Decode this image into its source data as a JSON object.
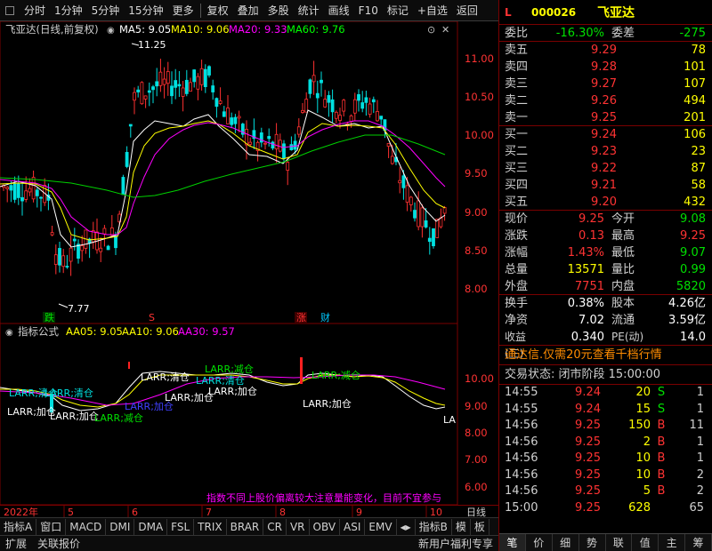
{
  "toolbar": {
    "items": [
      "分时",
      "1分钟",
      "5分钟",
      "15分钟",
      "更多",
      "复权",
      "叠加",
      "多股",
      "统计",
      "画线",
      "F10",
      "标记",
      "+自选",
      "返回"
    ]
  },
  "chart_header": {
    "stock": "飞亚达(日线,前复权)",
    "ma5": "MA5: 9.05",
    "ma10": "MA10: 9.06",
    "ma20": "MA20: 9.33",
    "ma60": "MA60: 9.76"
  },
  "indicator_header": {
    "name": "指标公式",
    "aa05": "AA05: 9.05",
    "aa10": "AA10: 9.06",
    "aa30": "AA30: 9.57"
  },
  "price_annotations": {
    "high": "11.25",
    "low": "7.77"
  },
  "price_axis": [
    "11.00",
    "10.50",
    "10.00",
    "9.50",
    "9.00",
    "8.50",
    "8.00"
  ],
  "ind_axis": [
    "10.00",
    "9.00",
    "8.00",
    "7.00",
    "6.00"
  ],
  "event_markers": {
    "die": "跌",
    "s": "S",
    "zhang": "涨",
    "cai": "财"
  },
  "ind_labels": [
    {
      "t": "LARR;清仓"
    },
    {
      "t": "LARR;清仓"
    },
    {
      "t": "LARR;加仓"
    },
    {
      "t": "LARR;加仓"
    },
    {
      "t": "LARR;减仓"
    },
    {
      "t": "LARR;加仓"
    },
    {
      "t": "LARR;清仓"
    },
    {
      "t": "LARR;加仓"
    },
    {
      "t": "LARR;减仓"
    },
    {
      "t": "LARR;清仓"
    },
    {
      "t": "LARR;加仓"
    },
    {
      "t": "LARR;减仓"
    },
    {
      "t": "LARR;加仓"
    },
    {
      "t": "LA"
    }
  ],
  "warning": "指数不同上股价偏离较大注意量能变化，目前不宜参与",
  "date_axis": {
    "year": "2022年",
    "months": [
      "5",
      "6",
      "7",
      "8",
      "9",
      "10"
    ],
    "period": "日线"
  },
  "bottom_tabs": [
    "指标A",
    "窗口",
    "MACD",
    "DMI",
    "DMA",
    "FSL",
    "TRIX",
    "BRAR",
    "CR",
    "VR",
    "OBV",
    "ASI",
    "EMV",
    "指标B",
    "模",
    "板"
  ],
  "status_bar": {
    "expand": "扩展",
    "link": "关联报价",
    "promo": "新用户福利专享"
  },
  "quote": {
    "mark": "L",
    "code": "000026",
    "name": "飞亚达",
    "weibi_label": "委比",
    "weibi": "-16.30%",
    "weicha_label": "委差",
    "weicha": "-275",
    "asks": [
      {
        "label": "卖五",
        "price": "9.29",
        "vol": "78"
      },
      {
        "label": "卖四",
        "price": "9.28",
        "vol": "101"
      },
      {
        "label": "卖三",
        "price": "9.27",
        "vol": "107"
      },
      {
        "label": "卖二",
        "price": "9.26",
        "vol": "494"
      },
      {
        "label": "卖一",
        "price": "9.25",
        "vol": "201"
      }
    ],
    "bids": [
      {
        "label": "买一",
        "price": "9.24",
        "vol": "106"
      },
      {
        "label": "买二",
        "price": "9.23",
        "vol": "23"
      },
      {
        "label": "买三",
        "price": "9.22",
        "vol": "87"
      },
      {
        "label": "买四",
        "price": "9.21",
        "vol": "58"
      },
      {
        "label": "买五",
        "price": "9.20",
        "vol": "432"
      }
    ],
    "stats": [
      {
        "l1": "现价",
        "v1": "9.25",
        "c1": "red",
        "l2": "今开",
        "v2": "9.08",
        "c2": "green"
      },
      {
        "l1": "涨跌",
        "v1": "0.13",
        "c1": "red",
        "l2": "最高",
        "v2": "9.25",
        "c2": "red"
      },
      {
        "l1": "涨幅",
        "v1": "1.43%",
        "c1": "red",
        "l2": "最低",
        "v2": "9.07",
        "c2": "green"
      },
      {
        "l1": "总量",
        "v1": "13571",
        "c1": "yellow",
        "l2": "量比",
        "v2": "0.99",
        "c2": "green"
      },
      {
        "l1": "外盘",
        "v1": "7751",
        "c1": "red",
        "l2": "内盘",
        "v2": "5820",
        "c2": "green"
      }
    ],
    "stats2": [
      {
        "l1": "换手",
        "v1": "0.38%",
        "l2": "股本",
        "v2": "4.26亿"
      },
      {
        "l1": "净资",
        "v1": "7.02",
        "l2": "流通",
        "v2": "3.59亿"
      },
      {
        "l1": "收益(三)",
        "v1": "0.340",
        "l2": "PE(动)",
        "v2": "14.0"
      }
    ],
    "notice": "通达信.仅需20元查看千档行情",
    "trade_state": "交易状态: 闭市阶段 15:00:00",
    "ticks": [
      {
        "t": "14:55",
        "p": "9.24",
        "v": "20",
        "f": "S",
        "n": "1"
      },
      {
        "t": "14:55",
        "p": "9.24",
        "v": "15",
        "f": "S",
        "n": "1"
      },
      {
        "t": "14:56",
        "p": "9.25",
        "v": "150",
        "f": "B",
        "n": "11"
      },
      {
        "t": "14:56",
        "p": "9.25",
        "v": "2",
        "f": "B",
        "n": "1"
      },
      {
        "t": "14:56",
        "p": "9.25",
        "v": "10",
        "f": "B",
        "n": "1"
      },
      {
        "t": "14:56",
        "p": "9.25",
        "v": "10",
        "f": "B",
        "n": "2"
      },
      {
        "t": "14:56",
        "p": "9.25",
        "v": "5",
        "f": "B",
        "n": "2"
      },
      {
        "t": "15:00",
        "p": "9.25",
        "v": "628",
        "f": "",
        "n": "65"
      }
    ],
    "tabs": [
      "笔",
      "价",
      "细",
      "势",
      "联",
      "值",
      "主",
      "筹"
    ]
  },
  "chart_data": {
    "type": "candlestick",
    "ylim": [
      7.7,
      11.4
    ],
    "ma5_last": 9.05,
    "ma10_last": 9.06,
    "ma20_last": 9.33,
    "ma60_last": 9.76,
    "period_high": 11.25,
    "period_low": 7.77
  }
}
